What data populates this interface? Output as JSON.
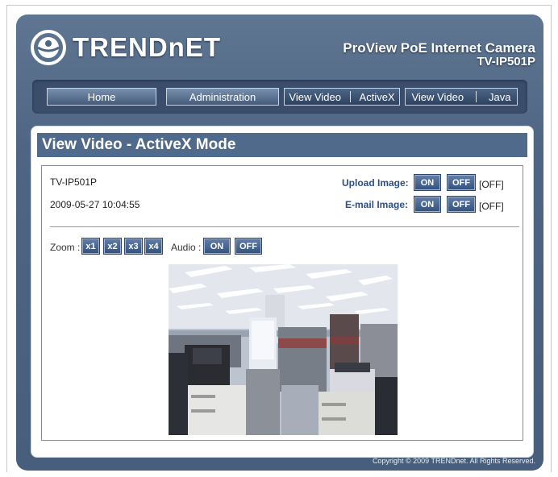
{
  "brand": {
    "logo_text": "TRENDnET"
  },
  "product": {
    "name": "ProView PoE Internet Camera",
    "model": "TV-IP501P"
  },
  "nav": {
    "home": "Home",
    "administration": "Administration",
    "view_video_activex": {
      "part1": "View Video",
      "part2": "ActiveX"
    },
    "view_video_java": {
      "part1": "View Video",
      "part2": "Java"
    }
  },
  "section": {
    "title": "View Video - ActiveX Mode"
  },
  "camera": {
    "name": "TV-IP501P",
    "datetime": "2009-05-27 10:04:55"
  },
  "upload_image": {
    "label": "Upload Image:",
    "on": "ON",
    "off": "OFF",
    "status": "[OFF]"
  },
  "email_image": {
    "label": "E-mail Image:",
    "on": "ON",
    "off": "OFF",
    "status": "[OFF]"
  },
  "zoom": {
    "label": "Zoom :",
    "options": [
      "x1",
      "x2",
      "x3",
      "x4"
    ]
  },
  "audio": {
    "label": "Audio :",
    "on": "ON",
    "off": "OFF"
  },
  "footer": {
    "copyright": "Copyright © 2009 TRENDnet. All Rights Reserved."
  },
  "colors": {
    "frame": "#4e6584",
    "title_bar": "#506a8c",
    "accent_text": "#2c4f86"
  }
}
